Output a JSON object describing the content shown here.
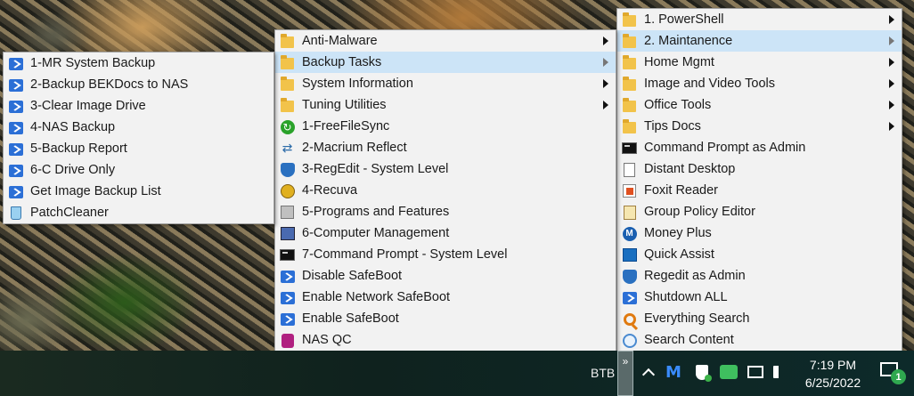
{
  "menu_backup_tasks": {
    "items": [
      {
        "label": "1-MR System Backup",
        "icon": "powershell-icon"
      },
      {
        "label": "2-Backup BEKDocs to NAS",
        "icon": "powershell-icon"
      },
      {
        "label": "3-Clear Image Drive",
        "icon": "powershell-icon"
      },
      {
        "label": "4-NAS Backup",
        "icon": "powershell-icon"
      },
      {
        "label": "5-Backup Report",
        "icon": "powershell-icon"
      },
      {
        "label": "6-C Drive Only",
        "icon": "powershell-icon"
      },
      {
        "label": "Get Image Backup List",
        "icon": "powershell-icon"
      },
      {
        "label": "PatchCleaner",
        "icon": "recycle-bin-icon"
      }
    ]
  },
  "menu_maintenance": {
    "items": [
      {
        "label": "Anti-Malware",
        "icon": "folder-icon",
        "submenu": true
      },
      {
        "label": "Backup Tasks",
        "icon": "folder-icon",
        "submenu": true,
        "highlighted": true
      },
      {
        "label": "System Information",
        "icon": "folder-icon",
        "submenu": true
      },
      {
        "label": "Tuning Utilities",
        "icon": "folder-icon",
        "submenu": true
      },
      {
        "label": "1-FreeFileSync",
        "icon": "sync-icon"
      },
      {
        "label": "2-Macrium Reflect",
        "icon": "macrium-icon"
      },
      {
        "label": "3-RegEdit - System Level",
        "icon": "regedit-icon"
      },
      {
        "label": "4-Recuva",
        "icon": "recuva-icon"
      },
      {
        "label": "5-Programs and Features",
        "icon": "programs-icon"
      },
      {
        "label": "6-Computer Management",
        "icon": "computer-management-icon"
      },
      {
        "label": "7-Command Prompt - System Level",
        "icon": "command-prompt-icon"
      },
      {
        "label": "Disable SafeBoot",
        "icon": "powershell-icon"
      },
      {
        "label": "Enable Network SafeBoot",
        "icon": "powershell-icon"
      },
      {
        "label": "Enable SafeBoot",
        "icon": "powershell-icon"
      },
      {
        "label": "NAS QC",
        "icon": "nas-qc-icon"
      }
    ]
  },
  "menu_root": {
    "items": [
      {
        "label": "1. PowerShell",
        "icon": "folder-icon",
        "submenu": true
      },
      {
        "label": "2. Maintanence",
        "icon": "folder-icon",
        "submenu": true,
        "highlighted": true
      },
      {
        "label": "Home Mgmt",
        "icon": "folder-icon",
        "submenu": true
      },
      {
        "label": "Image and Video Tools",
        "icon": "folder-icon",
        "submenu": true
      },
      {
        "label": "Office Tools",
        "icon": "folder-icon",
        "submenu": true
      },
      {
        "label": "Tips Docs",
        "icon": "folder-icon",
        "submenu": true
      },
      {
        "label": "Command Prompt as Admin",
        "icon": "command-prompt-icon"
      },
      {
        "label": "Distant Desktop",
        "icon": "document-icon"
      },
      {
        "label": "Foxit Reader",
        "icon": "foxit-icon"
      },
      {
        "label": "Group Policy Editor",
        "icon": "group-policy-icon"
      },
      {
        "label": "Money Plus",
        "icon": "money-icon"
      },
      {
        "label": "Quick Assist",
        "icon": "quick-assist-icon"
      },
      {
        "label": "Regedit as Admin",
        "icon": "regedit-icon"
      },
      {
        "label": "Shutdown ALL",
        "icon": "powershell-icon"
      },
      {
        "label": "Everything Search",
        "icon": "everything-search-icon"
      },
      {
        "label": "Search Content",
        "icon": "magnifier-icon"
      }
    ]
  },
  "taskbar": {
    "toolbar_label": "BTB",
    "chevron": "»",
    "time": "7:19 PM",
    "date": "6/25/2022",
    "notification_count": "1",
    "malware_glyph": "M",
    "money_glyph": "M"
  },
  "colors": {
    "highlight": "#cce4f7",
    "menu_bg": "#f2f2f2",
    "taskbar_bg": "#0f221e",
    "badge": "#2fa84f"
  }
}
